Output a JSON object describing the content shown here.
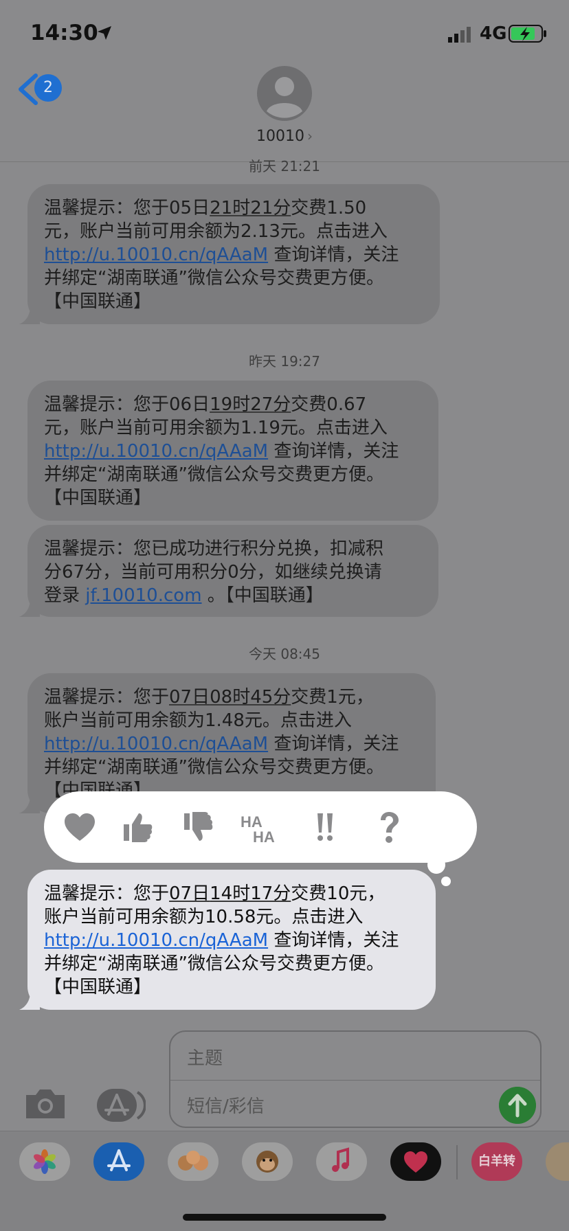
{
  "status_bar": {
    "time": "14:30",
    "network": "4G"
  },
  "header": {
    "back_badge": "2",
    "contact": "10010",
    "contact_chevron": "›"
  },
  "timestamps": [
    {
      "day": "前天",
      "time": "21:21"
    },
    {
      "day": "昨天",
      "time": "19:27"
    },
    {
      "day": "今天",
      "time": "08:45"
    }
  ],
  "messages": [
    {
      "l1a": "温馨提示：您于",
      "l1b": "05日",
      "l1c": "21时21分",
      "l1d": "交费1.50",
      "l2": "元，账户当前可用余额为2.13元。点击进入",
      "link": "http://u.10010.cn/qAAaM",
      "l3b": " 查询详情，关注",
      "l4": "并绑定“湖南联通”微信公众号交费更方便。",
      "l5": "【中国联通】"
    },
    {
      "l1a": "温馨提示：您于",
      "l1b": "06日",
      "l1c": "19时27分",
      "l1d": "交费0.67",
      "l2": "元，账户当前可用余额为1.19元。点击进入",
      "link": "http://u.10010.cn/qAAaM",
      "l3b": " 查询详情，关注",
      "l4": "并绑定“湖南联通”微信公众号交费更方便。",
      "l5": "【中国联通】"
    },
    {
      "l1": "温馨提示：您已成功进行积分兑换，扣减积",
      "l2": "分67分，当前可用积分0分，如继续兑换请",
      "l3a": "登录 ",
      "link": "jf.10010.com",
      "l3b": " 。【中国联通】"
    },
    {
      "l1a": "温馨提示：您于",
      "l1b": "07日",
      "l1c": "08时45分",
      "l1d": "交费1元，",
      "l2": "账户当前可用余额为1.48元。点击进入",
      "link": "http://u.10010.cn/qAAaM",
      "l3b": " 查询详情，关注",
      "l4": "并绑定“湖南联通”微信公众号交费更方便。",
      "l5": "【中国联通】"
    },
    {
      "l1a": "温馨提示：您于",
      "l1b": "07日",
      "l1c": "14时17分",
      "l1d": "交费10元，",
      "l2": "账户当前可用余额为10.58元。点击进入",
      "link": "http://u.10010.cn/qAAaM",
      "l3b": " 查询详情，关注",
      "l4": "并绑定“湖南联通”微信公众号交费更方便。",
      "l5": "【中国联通】"
    }
  ],
  "reactions": [
    "heart-icon",
    "thumbs-up-icon",
    "thumbs-down-icon",
    "haha-icon",
    "exclamation-icon",
    "question-icon"
  ],
  "composer": {
    "subject_placeholder": "主题",
    "body_placeholder": "短信/彩信"
  },
  "app_drawer": {
    "apps": [
      "photos-icon",
      "app-store-icon",
      "memoji-icon",
      "animoji-monkey-icon",
      "music-icon",
      "digital-touch-icon",
      "baiyangzhuan-icon",
      "sticker-icon"
    ],
    "baiyangzhuan_label": "白羊转"
  },
  "colors": {
    "link": "#1e4f95",
    "send_button": "#2a7d34",
    "badge": "#1f6fd1"
  }
}
